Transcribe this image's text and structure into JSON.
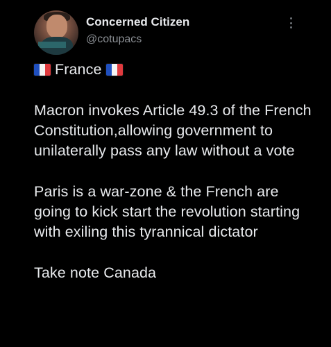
{
  "author": {
    "display_name": "Concerned Citizen",
    "handle": "@cotupacs"
  },
  "icons": {
    "more": "more-vertical-icon",
    "flag": "france-flag-icon"
  },
  "tweet": {
    "title": "France",
    "paragraphs": [
      "Macron invokes Article 49.3 of the French Constitution,allowing government to unilaterally pass any law without a vote",
      "Paris is a war-zone & the French are going to kick start the revolution starting with exiling this tyrannical dictator",
      "Take note Canada"
    ]
  },
  "colors": {
    "background": "#000000",
    "text": "#e8eaed",
    "muted": "#8b8f94",
    "flag_blue": "#1f4fbf",
    "flag_white": "#f4f4f4",
    "flag_red": "#e03a3e"
  }
}
